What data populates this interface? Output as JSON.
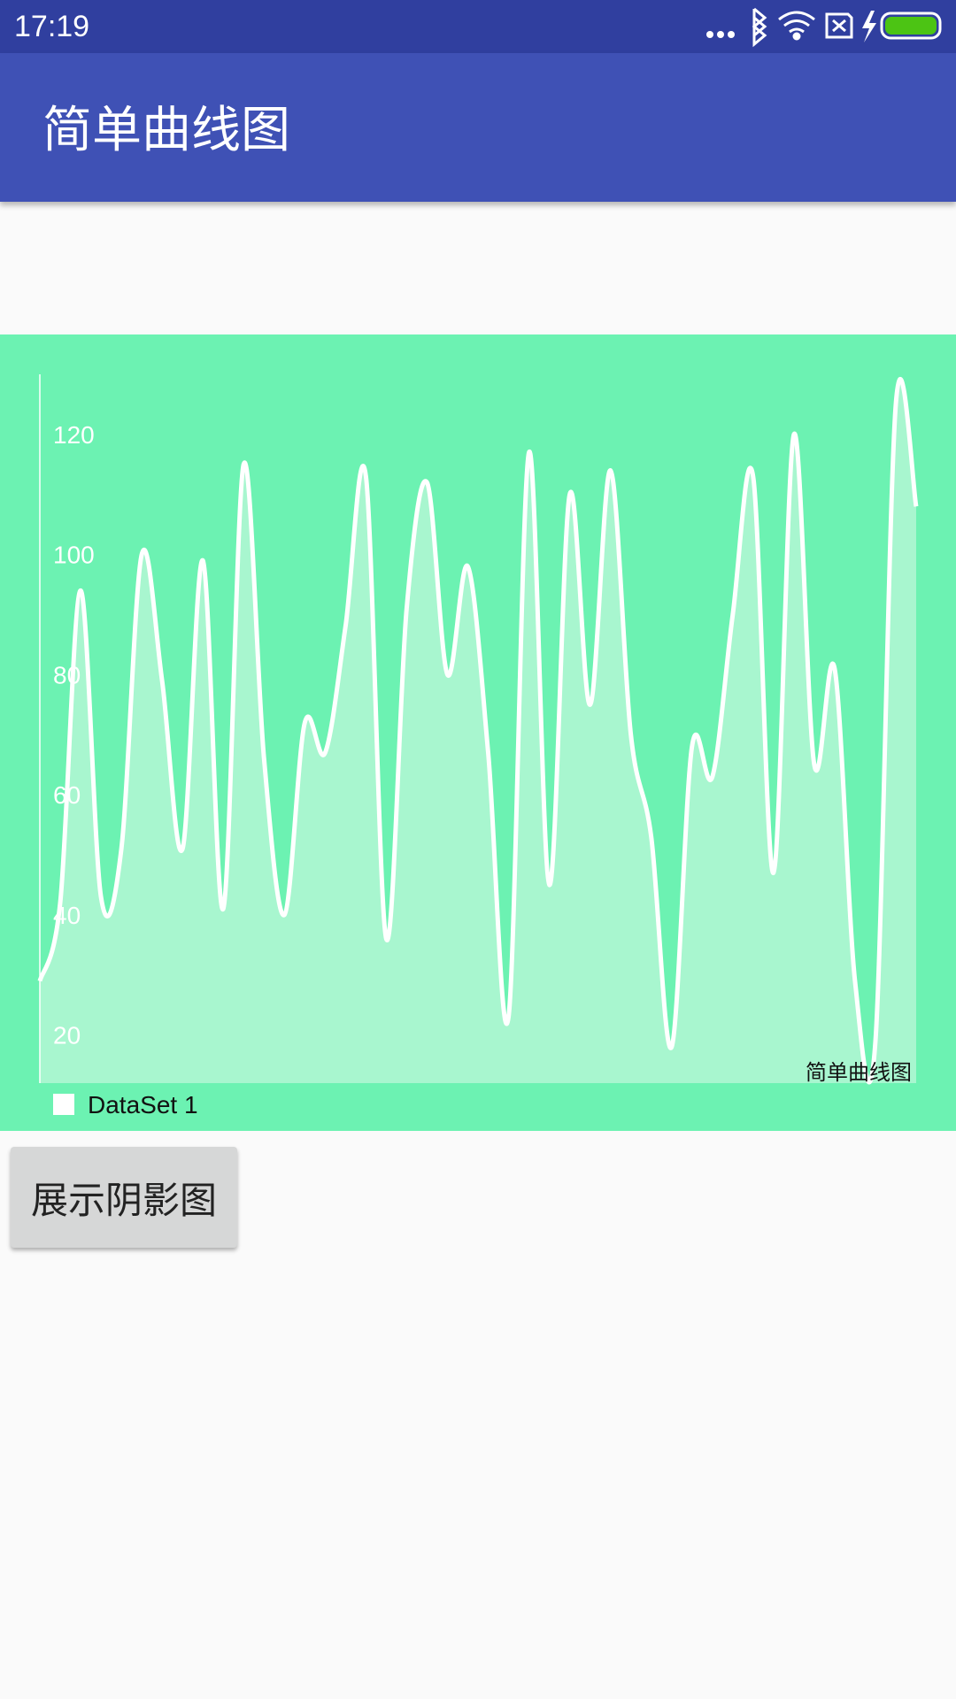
{
  "status_bar": {
    "time": "17:19",
    "icons": [
      "more-dots-icon",
      "bluetooth-icon",
      "wifi-icon",
      "sim-x-icon",
      "charging-icon",
      "battery-icon"
    ]
  },
  "app_bar": {
    "title": "简单曲线图"
  },
  "chart_data": {
    "type": "area",
    "curve": "cubic",
    "x": [
      0,
      1,
      2,
      3,
      4,
      5,
      6,
      7,
      8,
      9,
      10,
      11,
      12,
      13,
      14,
      15,
      16,
      17,
      18,
      19,
      20,
      21,
      22,
      23,
      24,
      25,
      26,
      27,
      28,
      29,
      30,
      31,
      32,
      33,
      34,
      35,
      36,
      37,
      38,
      39,
      40,
      41,
      42,
      43,
      44,
      45,
      46
    ],
    "series": [
      {
        "name": "DataSet 1",
        "values": [
          29,
          42,
          94,
          43,
          51,
          100,
          79,
          51,
          99,
          41,
          115,
          66,
          40,
          72,
          67,
          88,
          113,
          36,
          91,
          112,
          80,
          98,
          67,
          23,
          117,
          45,
          110,
          75,
          114,
          70,
          53,
          18,
          68,
          63,
          90,
          113,
          47,
          120,
          65,
          81,
          29,
          19,
          125,
          108
        ]
      }
    ],
    "ylim": [
      12,
      130
    ],
    "y_ticks": [
      "20",
      "40",
      "60",
      "80",
      "100",
      "120"
    ],
    "description_label": "简单曲线图",
    "legend_position": "bottom-left",
    "grid": false,
    "colors": {
      "background": "#6cf2b2",
      "line": "#ffffff",
      "fill": "#a8f6cf",
      "axis_text": "#ffffff"
    }
  },
  "actions": {
    "show_shadow_button": "展示阴影图"
  }
}
